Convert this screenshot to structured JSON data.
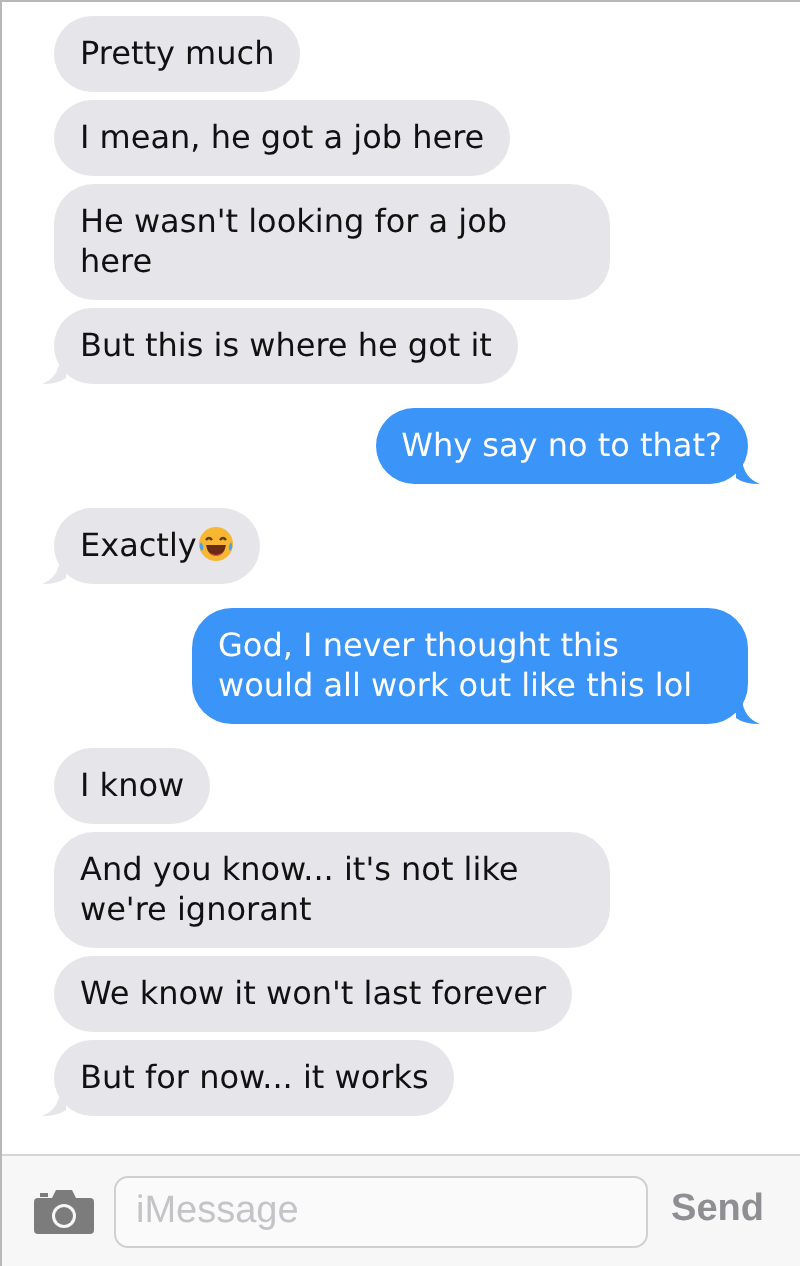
{
  "messages": [
    {
      "text": "Pretty much",
      "kind": "received",
      "tail": false
    },
    {
      "text": "I mean, he got a job here",
      "kind": "received",
      "tail": false
    },
    {
      "text": "He wasn't looking for a job here",
      "kind": "received",
      "tail": false
    },
    {
      "text": "But this is where he got it",
      "kind": "received",
      "tail": true
    },
    {
      "text": "Why say no to that?",
      "kind": "sent",
      "tail": true
    },
    {
      "text": "Exactly",
      "kind": "received",
      "tail": true,
      "emoji": true
    },
    {
      "text": "God, I never thought this would all work out like this lol",
      "kind": "sent",
      "tail": true
    },
    {
      "text": "I know",
      "kind": "received",
      "tail": false
    },
    {
      "text": "And you know... it's not like we're ignorant",
      "kind": "received",
      "tail": false
    },
    {
      "text": "We know it won't last forever",
      "kind": "received",
      "tail": false
    },
    {
      "text": "But for now... it works",
      "kind": "received",
      "tail": true
    }
  ],
  "composer": {
    "placeholder": "iMessage",
    "send": "Send"
  }
}
